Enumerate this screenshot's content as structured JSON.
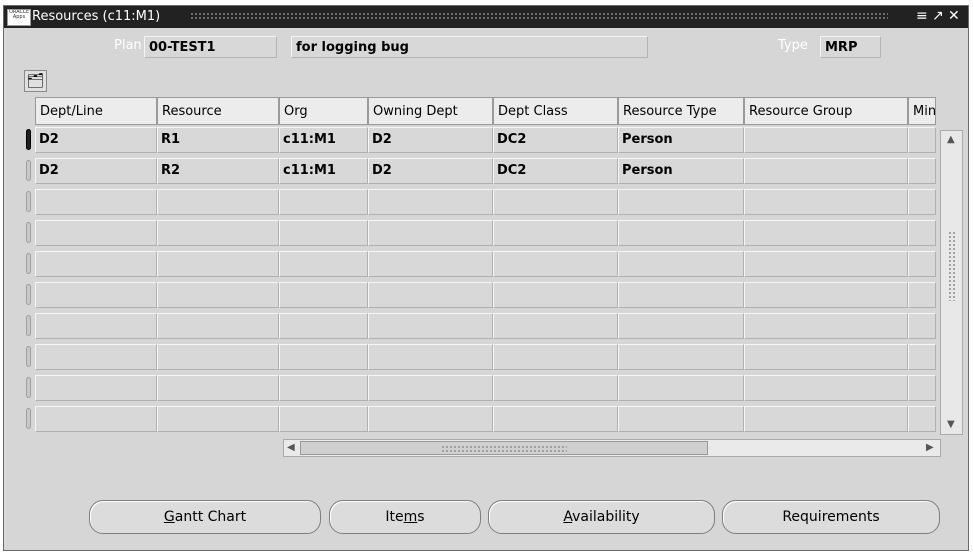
{
  "window": {
    "title": "Resources (c11:M1)"
  },
  "header": {
    "plan_label": "Plan",
    "plan_value": "00-TEST1",
    "plan_description": "for logging bug",
    "type_label": "Type",
    "type_value": "MRP"
  },
  "grid": {
    "columns": [
      "Dept/Line",
      "Resource",
      "Org",
      "Owning Dept",
      "Dept Class",
      "Resource Type",
      "Resource Group",
      "Min"
    ],
    "rows": [
      [
        "D2",
        "R1",
        "c11:M1",
        "D2",
        "DC2",
        "Person",
        "",
        ""
      ],
      [
        "D2",
        "R2",
        "c11:M1",
        "D2",
        "DC2",
        "Person",
        "",
        ""
      ],
      [
        "",
        "",
        "",
        "",
        "",
        "",
        "",
        ""
      ],
      [
        "",
        "",
        "",
        "",
        "",
        "",
        "",
        ""
      ],
      [
        "",
        "",
        "",
        "",
        "",
        "",
        "",
        ""
      ],
      [
        "",
        "",
        "",
        "",
        "",
        "",
        "",
        ""
      ],
      [
        "",
        "",
        "",
        "",
        "",
        "",
        "",
        ""
      ],
      [
        "",
        "",
        "",
        "",
        "",
        "",
        "",
        ""
      ],
      [
        "",
        "",
        "",
        "",
        "",
        "",
        "",
        ""
      ],
      [
        "",
        "",
        "",
        "",
        "",
        "",
        "",
        ""
      ]
    ]
  },
  "buttons": {
    "gantt": {
      "label": "Gantt Chart",
      "mnemonic": "G"
    },
    "items": {
      "label": "Items",
      "mnemonic": "m"
    },
    "availability": {
      "label": "Availability",
      "mnemonic": "A"
    },
    "requirements": {
      "label": "Requirements"
    }
  },
  "icons": [
    "window-logo-icon",
    "minimize-icon",
    "maximize-icon",
    "close-icon",
    "folder-icon",
    "scroll-up-icon",
    "scroll-down-icon",
    "scroll-left-icon",
    "scroll-right-icon"
  ]
}
